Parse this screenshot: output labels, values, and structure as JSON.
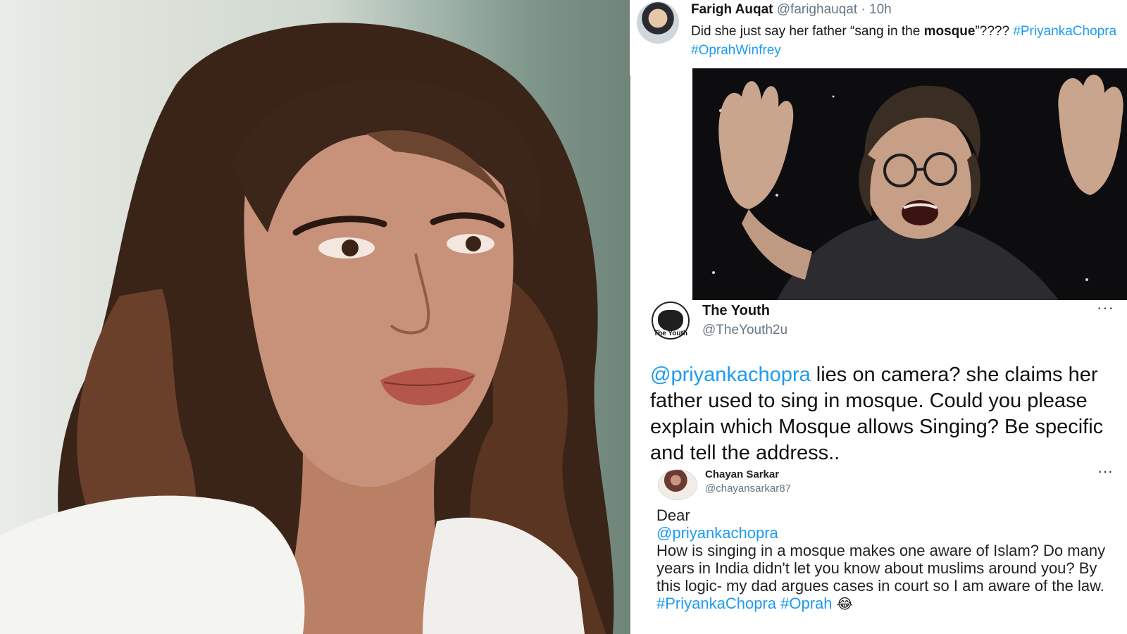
{
  "tweet1": {
    "name": "Farigh Auqat",
    "handle": "@farighauqat",
    "time": "· 10h",
    "text_before": "Did she just say her father “sang in the ",
    "text_bold": "mosque",
    "text_after": "”???? ",
    "tag1": "#PriyankaChopra",
    "tag2": "#OprahWinfrey"
  },
  "tweet2": {
    "name": "The Youth",
    "handle": "@TheYouth2u",
    "avatar_caption": "The Youth",
    "more": "···",
    "mention": "@priyankachopra",
    "text": " lies on camera? she claims her father used to sing in mosque. Could you please explain which Mosque allows Singing? Be specific and tell the address.."
  },
  "tweet3": {
    "name": "Chayan Sarkar",
    "handle": "@chayansarkar87",
    "more": "···",
    "greeting": "Dear",
    "mention": "@priyankachopra",
    "text": "How is singing in a mosque makes one aware of Islam? Do many years in India didn't let you know about muslims around you? By this logic- my dad argues cases in court so I am aware of the law.",
    "tag1": "#PriyankaChopra",
    "tag2": "#Oprah",
    "emoji": "😂"
  }
}
